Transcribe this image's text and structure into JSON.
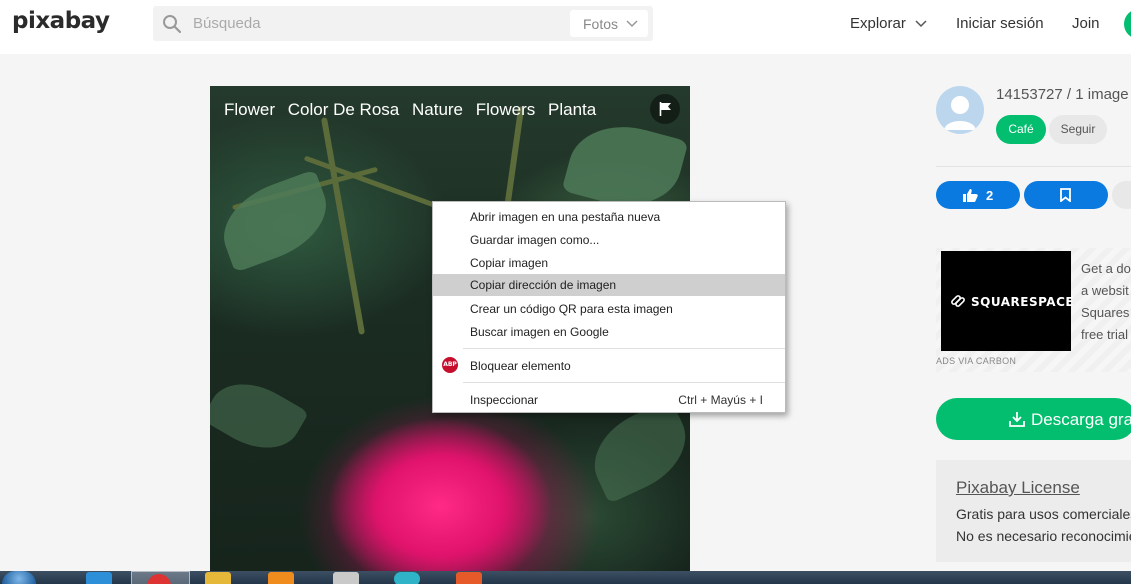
{
  "header": {
    "logo": "pixabay",
    "search": {
      "placeholder": "Búsqueda",
      "type_label": "Fotos"
    },
    "nav": {
      "explore": "Explorar",
      "login": "Iniciar sesión",
      "join": "Join"
    }
  },
  "photo": {
    "tags": [
      "Flower",
      "Color De Rosa",
      "Nature",
      "Flowers",
      "Planta"
    ]
  },
  "context_menu": {
    "items": [
      {
        "label": "Abrir imagen en una pestaña nueva"
      },
      {
        "label": "Guardar imagen como..."
      },
      {
        "label": "Copiar imagen"
      },
      {
        "label": "Copiar dirección de imagen",
        "highlighted": true
      },
      {
        "label": "Crear un código QR para esta imagen"
      },
      {
        "label": "Buscar imagen en Google"
      }
    ],
    "block": {
      "icon_text": "ABP",
      "label": "Bloquear elemento"
    },
    "inspect": {
      "label": "Inspeccionar",
      "shortcut": "Ctrl + Mayús + I"
    }
  },
  "sidebar": {
    "user": {
      "name_line": "14153727 / 1 image",
      "coffee": "Café",
      "follow": "Seguir"
    },
    "actions": {
      "likes": "2"
    },
    "ad": {
      "brand": "SQUARESPACE",
      "lines": [
        "Get a do",
        "a websit",
        "Squares",
        "free trial"
      ],
      "via": "ADS VIA CARBON"
    },
    "download_label": "Descarga gratuita",
    "license": {
      "title": "Pixabay License",
      "line1": "Gratis para usos comerciales",
      "line2": "No es necesario reconocimiento"
    }
  },
  "colors": {
    "brand_green": "#02be6e",
    "action_blue": "#0a7ae0",
    "menu_highlight": "#cfcfcf"
  },
  "icons": {
    "search": "search-icon",
    "chevron": "chevron-down-icon",
    "flag": "flag-icon",
    "like": "thumbs-up-icon",
    "save": "bookmark-icon",
    "download": "download-icon",
    "avatar": "user-avatar-icon"
  }
}
